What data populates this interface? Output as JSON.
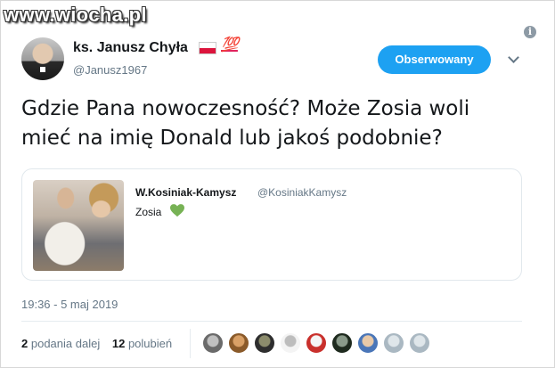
{
  "watermark": "www.wiocha.pl",
  "author": {
    "name": "ks. Janusz Chyła",
    "badge": "💯",
    "handle": "@Janusz1967"
  },
  "follow_button": "Obserwowany",
  "tweet": {
    "text": "Gdzie Pana nowoczesność? Może Zosia woli mieć na imię Donald lub jakoś podobnie?"
  },
  "quoted_tweet": {
    "author": "W.Kosiniak-Kamysz",
    "handle": "@KosiniakKamysz",
    "text": "Zosia",
    "heart_color": "#77b255"
  },
  "timestamp": "19:36 - 5 maj 2019",
  "stats": {
    "retweets_count": "2",
    "retweets_label": "podania dalej",
    "likes_count": "12",
    "likes_label": "polubień"
  },
  "likers": [
    {
      "color": "#6a6a6a",
      "color2": "#c0c0c0"
    },
    {
      "color": "#8a5a2a",
      "color2": "#d9a066"
    },
    {
      "color": "#2e2e2e",
      "color2": "#8c8c6c"
    },
    {
      "color": "#f4f4f4",
      "color2": "#bdbdbd"
    },
    {
      "color": "#c9302c",
      "color2": "#f5f5f5"
    },
    {
      "color": "#1e2a1e",
      "color2": "#8a9a8a"
    },
    {
      "color": "#4a76b8",
      "color2": "#e8c9a8"
    },
    {
      "color": "#aab8c2",
      "color2": "#dfe6ea"
    },
    {
      "color": "#aab8c2",
      "color2": "#dfe6ea"
    }
  ],
  "colors": {
    "accent": "#1da1f2",
    "secondary_text": "#657786",
    "border": "#e1e8ed"
  }
}
